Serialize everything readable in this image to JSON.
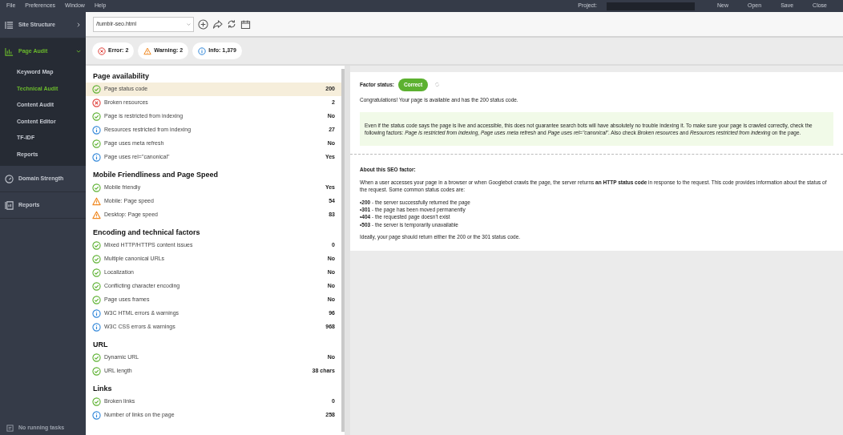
{
  "menu_bar": {
    "menus": [
      "File",
      "Preferences",
      "Window",
      "Help"
    ],
    "project_label": "Project:",
    "buttons": [
      "New",
      "Open",
      "Save",
      "Close"
    ]
  },
  "sidebar": {
    "items": [
      {
        "label": "Site Structure",
        "selected": false,
        "expanded": false
      },
      {
        "label": "Page Audit",
        "selected": true,
        "expanded": true,
        "children": [
          {
            "label": "Keyword Map",
            "selected": false
          },
          {
            "label": "Technical Audit",
            "selected": true
          },
          {
            "label": "Content Audit",
            "selected": false
          },
          {
            "label": "Content Editor",
            "selected": false
          },
          {
            "label": "TF-IDF",
            "selected": false
          },
          {
            "label": "Reports",
            "selected": false
          }
        ]
      },
      {
        "label": "Domain Strength",
        "selected": false,
        "expanded": false
      },
      {
        "label": "Reports",
        "selected": false,
        "expanded": false
      }
    ],
    "status": "No running tasks"
  },
  "toolbar": {
    "url": "/tumblr-seo.html"
  },
  "filters": [
    {
      "kind": "error",
      "label": "Error: 2"
    },
    {
      "kind": "warning",
      "label": "Warning: 2"
    },
    {
      "kind": "info",
      "label": "Info: 1,379"
    }
  ],
  "factors": [
    {
      "title": "Page availability",
      "rows": [
        {
          "kind": "ok",
          "label": "Page status code",
          "value": "200",
          "selected": true
        },
        {
          "kind": "error",
          "label": "Broken resources",
          "value": "2",
          "selected": false
        },
        {
          "kind": "ok",
          "label": "Page is restricted from indexing",
          "value": "No",
          "selected": false
        },
        {
          "kind": "info",
          "label": "Resources restricted from indexing",
          "value": "27",
          "selected": false
        },
        {
          "kind": "ok",
          "label": "Page uses meta refresh",
          "value": "No",
          "selected": false
        },
        {
          "kind": "info",
          "label": "Page uses rel=\"canonical\"",
          "value": "Yes",
          "selected": false
        }
      ]
    },
    {
      "title": "Mobile Friendliness and Page Speed",
      "rows": [
        {
          "kind": "ok",
          "label": "Mobile friendly",
          "value": "Yes",
          "selected": false
        },
        {
          "kind": "warning",
          "label": "Mobile: Page speed",
          "value": "54",
          "selected": false
        },
        {
          "kind": "warning",
          "label": "Desktop: Page speed",
          "value": "83",
          "selected": false
        }
      ]
    },
    {
      "title": "Encoding and technical factors",
      "rows": [
        {
          "kind": "ok",
          "label": "Mixed HTTP/HTTPS content issues",
          "value": "0",
          "selected": false
        },
        {
          "kind": "ok",
          "label": "Multiple canonical URLs",
          "value": "No",
          "selected": false
        },
        {
          "kind": "ok",
          "label": "Localization",
          "value": "No",
          "selected": false
        },
        {
          "kind": "ok",
          "label": "Conflicting character encoding",
          "value": "No",
          "selected": false
        },
        {
          "kind": "ok",
          "label": "Page uses frames",
          "value": "No",
          "selected": false
        },
        {
          "kind": "info",
          "label": "W3C HTML errors & warnings",
          "value": "96",
          "selected": false
        },
        {
          "kind": "info",
          "label": "W3C CSS errors & warnings",
          "value": "968",
          "selected": false
        }
      ]
    },
    {
      "title": "URL",
      "rows": [
        {
          "kind": "ok",
          "label": "Dynamic URL",
          "value": "No",
          "selected": false
        },
        {
          "kind": "ok",
          "label": "URL length",
          "value": "38 chars",
          "selected": false
        }
      ]
    },
    {
      "title": "Links",
      "rows": [
        {
          "kind": "ok",
          "label": "Broken links",
          "value": "0",
          "selected": false
        },
        {
          "kind": "info",
          "label": "Number of links on the page",
          "value": "258",
          "selected": false
        }
      ]
    }
  ],
  "details": {
    "status_label": "Factor status:",
    "status": "Correct",
    "summary": "Congratulations! Your page is available and has the 200 status code.",
    "tip": "Even if the status code says the page is live and accessible, this does not guarantee search bots will have absolutely no trouble indexing it. To make sure your page is crawled correctly, check the following factors: *Page is restricted from indexing*, *Page uses meta refresh* and *Page uses rel=\"canonical\"*. Also check *Broken resources* and *Resources restricted from indexing* on the page.",
    "about_title": "About this SEO factor:",
    "about": "When a user accesses your page in a browser or when Googlebot crawls the page, the server returns **an HTTP status code** in response to the request. This code provides information about the status of the request. Some common status codes are:",
    "codes": [
      "•**200** - the server successfully returned the page",
      "•**301** - the page has been moved permanently",
      "•**404** - the requested page doesn't exist",
      "•**503** - the server is temporarily unavailable"
    ],
    "conclusion": "Ideally, your page should return either the 200 or the 301 status code."
  }
}
